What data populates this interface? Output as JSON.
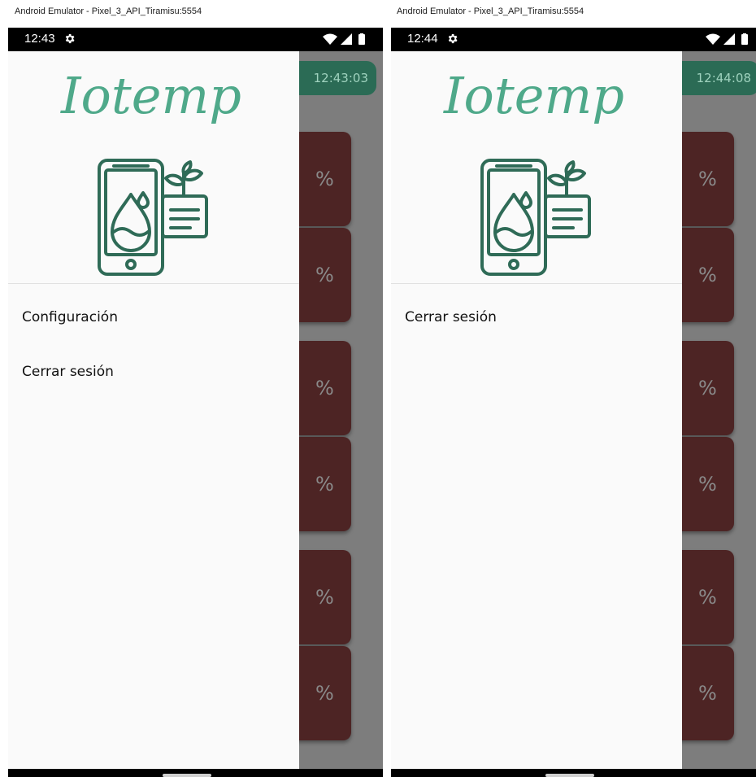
{
  "emulators": [
    {
      "window_title": "Android Emulator - Pixel_3_API_Tiramisu:5554",
      "status_time": "12:43",
      "app_clock": "12:43:03",
      "brand": "Iotemp",
      "menu_items": [
        "Configuración",
        "Cerrar sesión"
      ],
      "card_labels": [
        "%",
        "%",
        "%",
        "%",
        "%",
        "%"
      ]
    },
    {
      "window_title": "Android Emulator - Pixel_3_API_Tiramisu:5554",
      "status_time": "12:44",
      "app_clock": "12:44:08",
      "brand": "Iotemp",
      "menu_items": [
        "Cerrar sesión"
      ],
      "card_labels": [
        "%",
        "%",
        "%",
        "%",
        "%",
        "%"
      ]
    }
  ],
  "icons": {
    "settings": "gear-icon",
    "wifi": "wifi-icon",
    "signal": "signal-icon",
    "battery": "battery-icon",
    "logo": "phone-water-drop-plant-icon"
  },
  "colors": {
    "brand_green": "#4fa98a",
    "logo_dark_green": "#2f6b57",
    "card_maroon": "#4d2424",
    "clock_pill": "#2b6b55",
    "scrim": "#7d7d7d",
    "drawer_bg": "#fafafa"
  }
}
